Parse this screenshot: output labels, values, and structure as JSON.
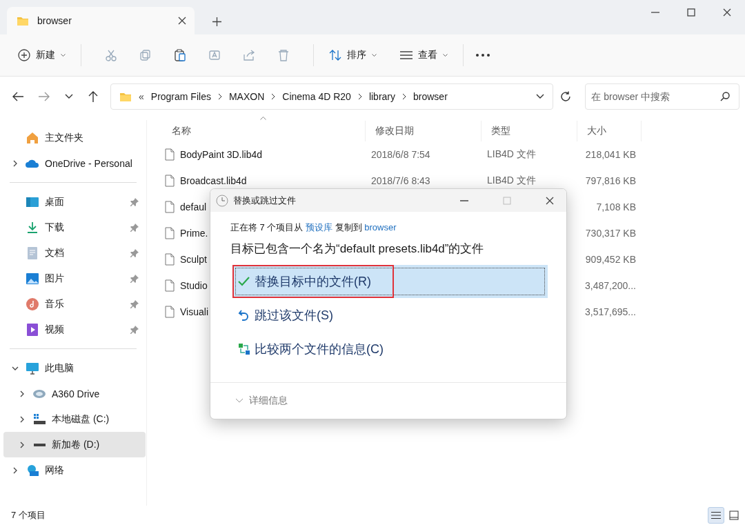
{
  "window": {
    "tab_title": "browser"
  },
  "toolbar": {
    "new_label": "新建",
    "sort_label": "排序",
    "view_label": "查看"
  },
  "address": {
    "overflow_mark": "«",
    "segments": [
      "Program Files",
      "MAXON",
      "Cinema 4D R20",
      "library",
      "browser"
    ],
    "search_placeholder": "在 browser 中搜索"
  },
  "sidebar": {
    "groups": [
      [
        {
          "kind": "home",
          "label": "主文件夹",
          "expandable": false,
          "expanded": false,
          "pinned": false,
          "selected": false
        },
        {
          "kind": "cloud",
          "label": "OneDrive - Personal",
          "expandable": true,
          "expanded": false,
          "pinned": false,
          "selected": false
        }
      ],
      [
        {
          "kind": "desktop",
          "label": "桌面",
          "expandable": false,
          "expanded": false,
          "pinned": true,
          "selected": false
        },
        {
          "kind": "download",
          "label": "下载",
          "expandable": false,
          "expanded": false,
          "pinned": true,
          "selected": false
        },
        {
          "kind": "document",
          "label": "文档",
          "expandable": false,
          "expanded": false,
          "pinned": true,
          "selected": false
        },
        {
          "kind": "picture",
          "label": "图片",
          "expandable": false,
          "expanded": false,
          "pinned": true,
          "selected": false
        },
        {
          "kind": "music",
          "label": "音乐",
          "expandable": false,
          "expanded": false,
          "pinned": true,
          "selected": false
        },
        {
          "kind": "video",
          "label": "视频",
          "expandable": false,
          "expanded": false,
          "pinned": true,
          "selected": false
        }
      ],
      [
        {
          "kind": "computer",
          "label": "此电脑",
          "expandable": true,
          "expanded": true,
          "pinned": false,
          "selected": false,
          "children": [
            {
              "kind": "netdrive",
              "label": "A360 Drive",
              "expandable": true,
              "expanded": false,
              "pinned": false,
              "selected": false
            },
            {
              "kind": "systemdrive",
              "label": "本地磁盘 (C:)",
              "expandable": true,
              "expanded": false,
              "pinned": false,
              "selected": false
            },
            {
              "kind": "drive",
              "label": "新加卷 (D:)",
              "expandable": true,
              "expanded": false,
              "pinned": false,
              "selected": true
            }
          ]
        },
        {
          "kind": "network",
          "label": "网络",
          "expandable": true,
          "expanded": false,
          "pinned": false,
          "selected": false
        }
      ]
    ]
  },
  "files": {
    "columns": [
      {
        "label": "名称",
        "sorted": true
      },
      {
        "label": "修改日期",
        "sorted": false
      },
      {
        "label": "类型",
        "sorted": false
      },
      {
        "label": "大小",
        "sorted": false
      }
    ],
    "rows": [
      {
        "name": "BodyPaint 3D.lib4d",
        "date": "2018/6/8 7:54",
        "type": "LIB4D 文件",
        "size": "218,041 KB"
      },
      {
        "name": "Broadcast.lib4d",
        "date": "2018/7/6 8:43",
        "type": "LIB4D 文件",
        "size": "797,816 KB"
      },
      {
        "name": "defaul",
        "size": "7,108 KB"
      },
      {
        "name": "Prime.",
        "size": "730,317 KB"
      },
      {
        "name": "Sculpt",
        "size": "909,452 KB"
      },
      {
        "name": "Studio",
        "size": "3,487,200..."
      },
      {
        "name": "Visuali",
        "size": "3,517,695..."
      }
    ]
  },
  "dialog": {
    "title": "替换或跳过文件",
    "status": [
      {
        "kind": "text",
        "text": "正在将 7 个项目从 "
      },
      {
        "kind": "link",
        "text": "预设库"
      },
      {
        "kind": "text",
        "text": " 复制到 "
      },
      {
        "kind": "link",
        "text": "browser"
      }
    ],
    "headline": "目标已包含一个名为“default presets.lib4d”的文件",
    "options": [
      {
        "kind": "replace",
        "label": "替换目标中的文件(R)",
        "selected": true,
        "highlighted": true
      },
      {
        "kind": "skip",
        "label": "跳过该文件(S)",
        "selected": false,
        "highlighted": false
      },
      {
        "kind": "compare",
        "label": "比较两个文件的信息(C)",
        "selected": false,
        "highlighted": false
      }
    ],
    "details": {
      "label": "详细信息",
      "expanded": false
    }
  },
  "status_bar": {
    "count": "7 个项目",
    "views": [
      {
        "kind": "details",
        "selected": true
      },
      {
        "kind": "tiles",
        "selected": false
      }
    ]
  }
}
